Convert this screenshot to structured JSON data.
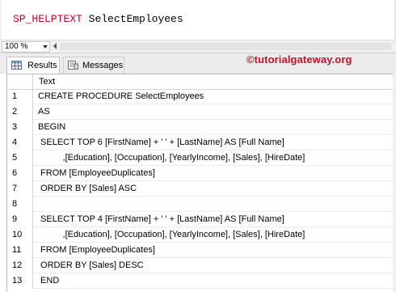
{
  "editor": {
    "keyword": "SP_HELPTEXT",
    "argument": "SelectEmployees"
  },
  "status": {
    "zoom": "100 %"
  },
  "tabs": {
    "results_label": "Results",
    "messages_label": "Messages"
  },
  "watermark": "©tutorialgateway.org",
  "grid": {
    "column_header": "Text",
    "rows": [
      {
        "n": "1",
        "text": "CREATE PROCEDURE SelectEmployees"
      },
      {
        "n": "2",
        "text": "AS"
      },
      {
        "n": "3",
        "text": "BEGIN"
      },
      {
        "n": "4",
        "text": " SELECT TOP 6 [FirstName] + ' ' + [LastName] AS [Full Name]"
      },
      {
        "n": "5",
        "text": "          ,[Education], [Occupation], [YearlyIncome], [Sales], [HireDate]"
      },
      {
        "n": "6",
        "text": " FROM [EmployeeDuplicates]"
      },
      {
        "n": "7",
        "text": " ORDER BY [Sales] ASC"
      },
      {
        "n": "8",
        "text": ""
      },
      {
        "n": "9",
        "text": " SELECT TOP 4 [FirstName] + ' ' + [LastName] AS [Full Name]"
      },
      {
        "n": "10",
        "text": "          ,[Education], [Occupation], [YearlyIncome], [Sales], [HireDate]"
      },
      {
        "n": "11",
        "text": " FROM [EmployeeDuplicates]"
      },
      {
        "n": "12",
        "text": " ORDER BY [Sales] DESC"
      },
      {
        "n": "13",
        "text": " END"
      }
    ]
  },
  "colors": {
    "keyword": "#c4002b",
    "watermark": "#c8102e"
  }
}
